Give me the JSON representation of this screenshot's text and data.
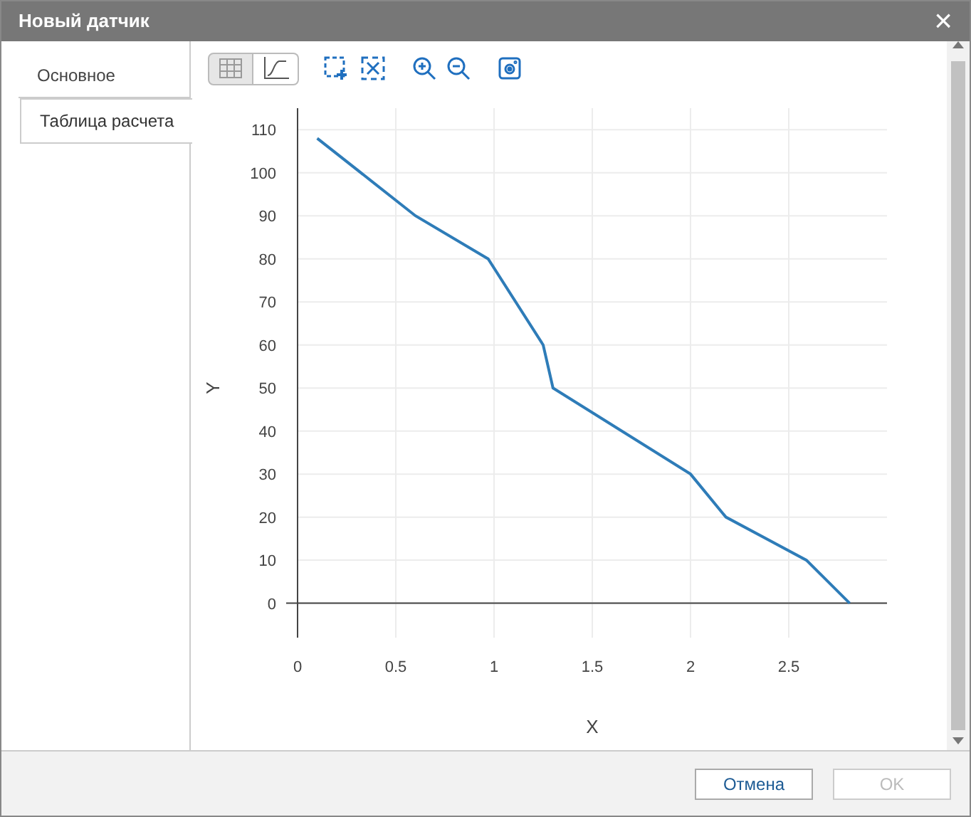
{
  "window": {
    "title": "Новый датчик",
    "close": "×"
  },
  "tabs": [
    {
      "label": "Основное",
      "selected": false
    },
    {
      "label": "Таблица расчета",
      "selected": true
    }
  ],
  "toolbar": {
    "view_toggle": [
      {
        "kind": "table",
        "selected": true
      },
      {
        "kind": "chart",
        "selected": false
      }
    ]
  },
  "chart_data": {
    "type": "line",
    "grid": true,
    "xlabel": "X",
    "ylabel": "Y",
    "xlim": [
      0,
      3
    ],
    "ylim": [
      -8,
      115
    ],
    "xticks": [
      0,
      0.5,
      1,
      1.5,
      2,
      2.5
    ],
    "yticks": [
      0,
      10,
      20,
      30,
      40,
      50,
      60,
      70,
      80,
      90,
      100,
      110
    ],
    "x": [
      0.1,
      0.6,
      0.97,
      1.25,
      1.3,
      2,
      2.18,
      2.59,
      2.81
    ],
    "series": [
      {
        "color": "#2e7cb8",
        "values": [
          108,
          90,
          80,
          60,
          50,
          30,
          20,
          10,
          0
        ]
      }
    ]
  },
  "buttons": [
    {
      "label": "Отмена",
      "disabled": false
    },
    {
      "label": "OK",
      "disabled": true
    }
  ]
}
